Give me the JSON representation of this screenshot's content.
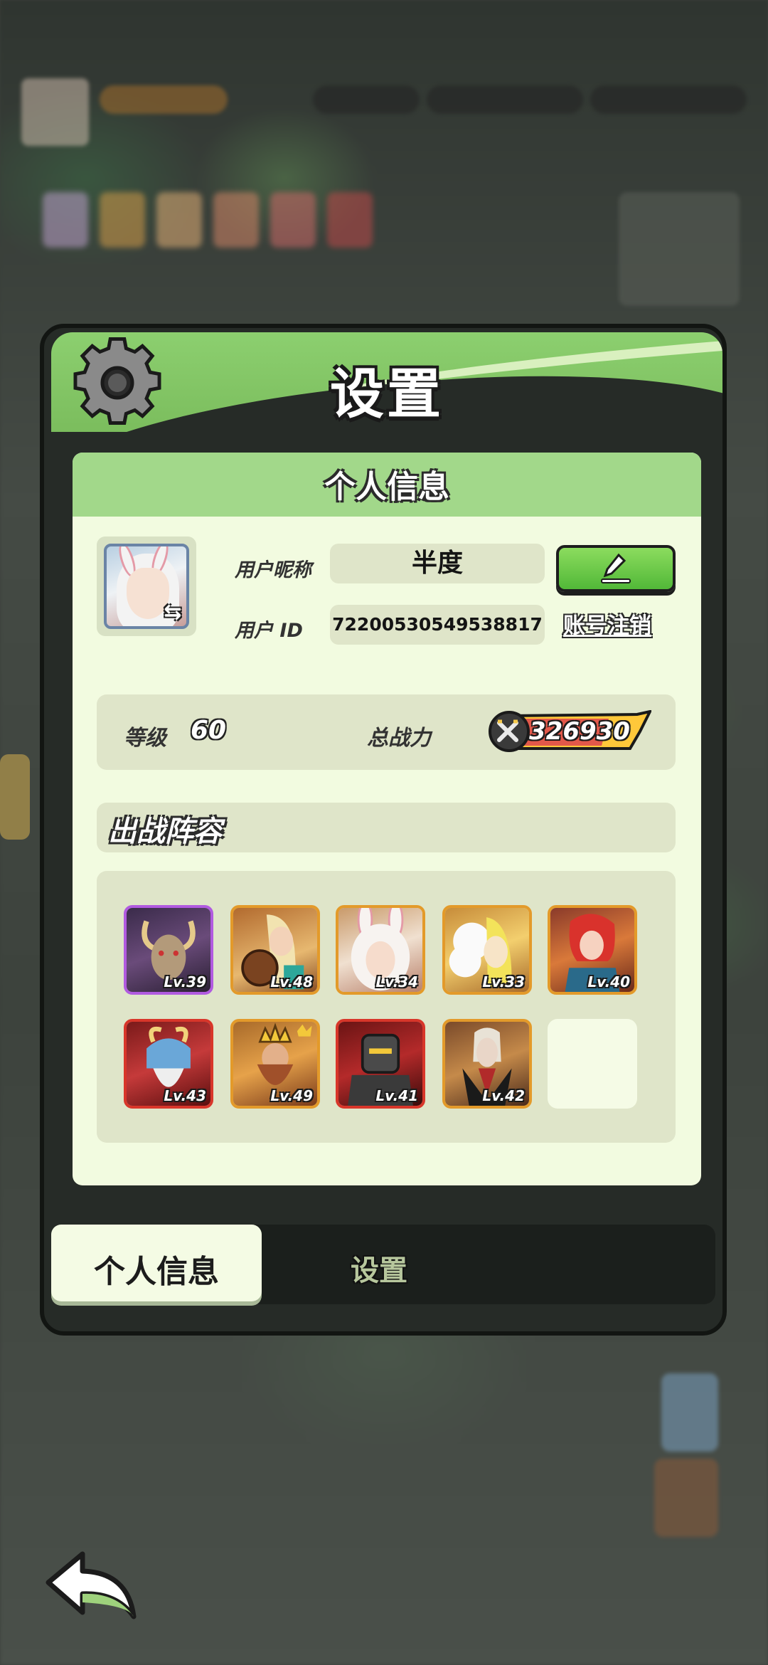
{
  "panel": {
    "title": "设置"
  },
  "profile": {
    "section_title": "个人信息",
    "nickname_label": "用户昵称",
    "nickname_value": "半度",
    "id_label": "用户  ID",
    "id_value": "72200530549538817",
    "logout_label": "账号注销"
  },
  "stats": {
    "level_label": "等级",
    "level_value": "60",
    "power_label": "总战力",
    "power_value": "326930"
  },
  "lineup": {
    "title": "出战阵容",
    "heroes": [
      {
        "level": "Lv.39",
        "rarity_color": "#b15ae0",
        "icon": "demon-goat-hero-icon"
      },
      {
        "level": "Lv.48",
        "rarity_color": "#e39a2a",
        "icon": "bard-lute-hero-icon"
      },
      {
        "level": "Lv.34",
        "rarity_color": "#e39a2a",
        "icon": "bunny-girl-hero-icon"
      },
      {
        "level": "Lv.33",
        "rarity_color": "#e39a2a",
        "icon": "flower-fairy-hero-icon"
      },
      {
        "level": "Lv.40",
        "rarity_color": "#e39a2a",
        "icon": "red-hair-warrior-hero-icon"
      },
      {
        "level": "Lv.43",
        "rarity_color": "#d8362a",
        "icon": "horned-helmet-hero-icon"
      },
      {
        "level": "Lv.49",
        "rarity_color": "#e39a2a",
        "icon": "king-crown-hero-icon"
      },
      {
        "level": "Lv.41",
        "rarity_color": "#d8362a",
        "icon": "dark-knight-hero-icon"
      },
      {
        "level": "Lv.42",
        "rarity_color": "#e39a2a",
        "icon": "vampire-hero-icon"
      }
    ]
  },
  "tabs": [
    {
      "label": "个人信息",
      "active": true
    },
    {
      "label": "设置",
      "active": false
    }
  ],
  "colors": {
    "header_green": "#8ccf6f",
    "panel_dark": "#262b27",
    "content_bg": "#f2fbe0",
    "edit_button": "#52b838"
  }
}
